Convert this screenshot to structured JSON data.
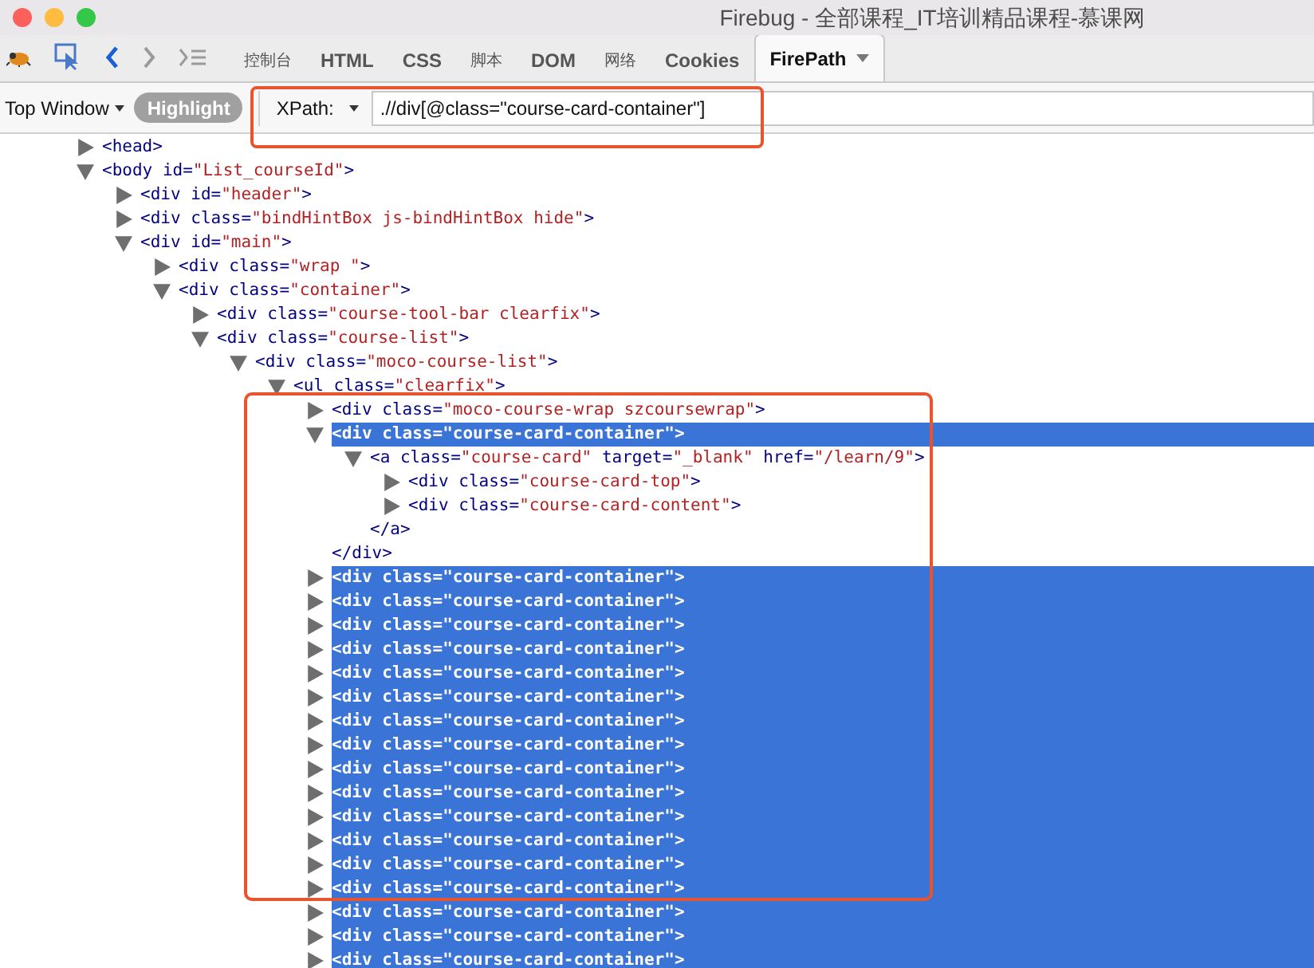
{
  "window": {
    "title": "Firebug - 全部课程_IT培训精品课程-慕课网"
  },
  "toolbar": {
    "tabs": [
      {
        "label": "控制台",
        "selected": false,
        "kind": "cjk"
      },
      {
        "label": "HTML",
        "selected": false,
        "kind": "latin"
      },
      {
        "label": "CSS",
        "selected": false,
        "kind": "latin"
      },
      {
        "label": "脚本",
        "selected": false,
        "kind": "cjk"
      },
      {
        "label": "DOM",
        "selected": false,
        "kind": "latin"
      },
      {
        "label": "网络",
        "selected": false,
        "kind": "cjk"
      },
      {
        "label": "Cookies",
        "selected": false,
        "kind": "latin"
      },
      {
        "label": "FirePath",
        "selected": true,
        "kind": "latin"
      }
    ]
  },
  "xpath_bar": {
    "context": "Top Window",
    "highlight_button": "Highlight",
    "mode": "XPath:",
    "value": ".//div[@class=\"course-card-container\"]"
  },
  "tree": [
    {
      "tag": "<head",
      "end": ">",
      "expanded": false,
      "selected": false
    },
    {
      "tag": "<body",
      "attrs": [
        {
          "name": "id=",
          "value": "\"List_courseId\""
        }
      ],
      "end": ">",
      "expanded": true,
      "selected": false,
      "children": [
        {
          "tag": "<div",
          "attrs": [
            {
              "name": "id=",
              "value": "\"header\""
            }
          ],
          "end": ">",
          "expanded": false,
          "selected": false
        },
        {
          "tag": "<div",
          "attrs": [
            {
              "name": "class=",
              "value": "\"bindHintBox js-bindHintBox hide\""
            }
          ],
          "end": ">",
          "expanded": false,
          "selected": false
        },
        {
          "tag": "<div",
          "attrs": [
            {
              "name": "id=",
              "value": "\"main\""
            }
          ],
          "end": ">",
          "expanded": true,
          "selected": false,
          "children": [
            {
              "tag": "<div",
              "attrs": [
                {
                  "name": "class=",
                  "value": "\"wrap \""
                }
              ],
              "end": ">",
              "expanded": false,
              "selected": false
            },
            {
              "tag": "<div",
              "attrs": [
                {
                  "name": "class=",
                  "value": "\"container\""
                }
              ],
              "end": ">",
              "expanded": true,
              "selected": false,
              "children": [
                {
                  "tag": "<div",
                  "attrs": [
                    {
                      "name": "class=",
                      "value": "\"course-tool-bar clearfix\""
                    }
                  ],
                  "end": ">",
                  "expanded": false,
                  "selected": false
                },
                {
                  "tag": "<div",
                  "attrs": [
                    {
                      "name": "class=",
                      "value": "\"course-list\""
                    }
                  ],
                  "end": ">",
                  "expanded": true,
                  "selected": false,
                  "children": [
                    {
                      "tag": "<div",
                      "attrs": [
                        {
                          "name": "class=",
                          "value": "\"moco-course-list\""
                        }
                      ],
                      "end": ">",
                      "expanded": true,
                      "selected": false,
                      "children": [
                        {
                          "tag": "<ul",
                          "attrs": [
                            {
                              "name": "class=",
                              "value": "\"clearfix\""
                            }
                          ],
                          "end": ">",
                          "expanded": true,
                          "selected": false,
                          "children": [
                            {
                              "tag": "<div",
                              "attrs": [
                                {
                                  "name": "class=",
                                  "value": "\"moco-course-wrap szcoursewrap\""
                                }
                              ],
                              "end": ">",
                              "expanded": false,
                              "selected": false
                            },
                            {
                              "tag": "<div",
                              "attrs": [
                                {
                                  "name": "class=",
                                  "value": "\"course-card-container\""
                                }
                              ],
                              "end": ">",
                              "expanded": true,
                              "selected": true,
                              "closing": "</div>",
                              "children": [
                                {
                                  "tag": "<a",
                                  "attrs": [
                                    {
                                      "name": "class=",
                                      "value": "\"course-card\""
                                    },
                                    {
                                      "name": "target=",
                                      "value": "\"_blank\""
                                    },
                                    {
                                      "name": "href=",
                                      "value": "\"/learn/9\""
                                    }
                                  ],
                                  "end": ">",
                                  "expanded": true,
                                  "selected": false,
                                  "closing": "</a>",
                                  "children": [
                                    {
                                      "tag": "<div",
                                      "attrs": [
                                        {
                                          "name": "class=",
                                          "value": "\"course-card-top\""
                                        }
                                      ],
                                      "end": ">",
                                      "expanded": false,
                                      "selected": false
                                    },
                                    {
                                      "tag": "<div",
                                      "attrs": [
                                        {
                                          "name": "class=",
                                          "value": "\"course-card-content\""
                                        }
                                      ],
                                      "end": ">",
                                      "expanded": false,
                                      "selected": false
                                    }
                                  ]
                                }
                              ]
                            },
                            {
                              "tag": "<div",
                              "attrs": [
                                {
                                  "name": "class=",
                                  "value": "\"course-card-container\""
                                }
                              ],
                              "end": ">",
                              "expanded": false,
                              "selected": true
                            },
                            {
                              "tag": "<div",
                              "attrs": [
                                {
                                  "name": "class=",
                                  "value": "\"course-card-container\""
                                }
                              ],
                              "end": ">",
                              "expanded": false,
                              "selected": true
                            },
                            {
                              "tag": "<div",
                              "attrs": [
                                {
                                  "name": "class=",
                                  "value": "\"course-card-container\""
                                }
                              ],
                              "end": ">",
                              "expanded": false,
                              "selected": true
                            },
                            {
                              "tag": "<div",
                              "attrs": [
                                {
                                  "name": "class=",
                                  "value": "\"course-card-container\""
                                }
                              ],
                              "end": ">",
                              "expanded": false,
                              "selected": true
                            },
                            {
                              "tag": "<div",
                              "attrs": [
                                {
                                  "name": "class=",
                                  "value": "\"course-card-container\""
                                }
                              ],
                              "end": ">",
                              "expanded": false,
                              "selected": true
                            },
                            {
                              "tag": "<div",
                              "attrs": [
                                {
                                  "name": "class=",
                                  "value": "\"course-card-container\""
                                }
                              ],
                              "end": ">",
                              "expanded": false,
                              "selected": true
                            },
                            {
                              "tag": "<div",
                              "attrs": [
                                {
                                  "name": "class=",
                                  "value": "\"course-card-container\""
                                }
                              ],
                              "end": ">",
                              "expanded": false,
                              "selected": true
                            },
                            {
                              "tag": "<div",
                              "attrs": [
                                {
                                  "name": "class=",
                                  "value": "\"course-card-container\""
                                }
                              ],
                              "end": ">",
                              "expanded": false,
                              "selected": true
                            },
                            {
                              "tag": "<div",
                              "attrs": [
                                {
                                  "name": "class=",
                                  "value": "\"course-card-container\""
                                }
                              ],
                              "end": ">",
                              "expanded": false,
                              "selected": true
                            },
                            {
                              "tag": "<div",
                              "attrs": [
                                {
                                  "name": "class=",
                                  "value": "\"course-card-container\""
                                }
                              ],
                              "end": ">",
                              "expanded": false,
                              "selected": true
                            },
                            {
                              "tag": "<div",
                              "attrs": [
                                {
                                  "name": "class=",
                                  "value": "\"course-card-container\""
                                }
                              ],
                              "end": ">",
                              "expanded": false,
                              "selected": true
                            },
                            {
                              "tag": "<div",
                              "attrs": [
                                {
                                  "name": "class=",
                                  "value": "\"course-card-container\""
                                }
                              ],
                              "end": ">",
                              "expanded": false,
                              "selected": true
                            },
                            {
                              "tag": "<div",
                              "attrs": [
                                {
                                  "name": "class=",
                                  "value": "\"course-card-container\""
                                }
                              ],
                              "end": ">",
                              "expanded": false,
                              "selected": true
                            },
                            {
                              "tag": "<div",
                              "attrs": [
                                {
                                  "name": "class=",
                                  "value": "\"course-card-container\""
                                }
                              ],
                              "end": ">",
                              "expanded": false,
                              "selected": true
                            },
                            {
                              "tag": "<div",
                              "attrs": [
                                {
                                  "name": "class=",
                                  "value": "\"course-card-container\""
                                }
                              ],
                              "end": ">",
                              "expanded": false,
                              "selected": true
                            },
                            {
                              "tag": "<div",
                              "attrs": [
                                {
                                  "name": "class=",
                                  "value": "\"course-card-container\""
                                }
                              ],
                              "end": ">",
                              "expanded": false,
                              "selected": true
                            },
                            {
                              "tag": "<div",
                              "attrs": [
                                {
                                  "name": "class=",
                                  "value": "\"course-card-container\""
                                }
                              ],
                              "end": ">",
                              "expanded": false,
                              "selected": true
                            }
                          ]
                        }
                      ]
                    }
                  ]
                }
              ]
            }
          ]
        }
      ]
    }
  ]
}
